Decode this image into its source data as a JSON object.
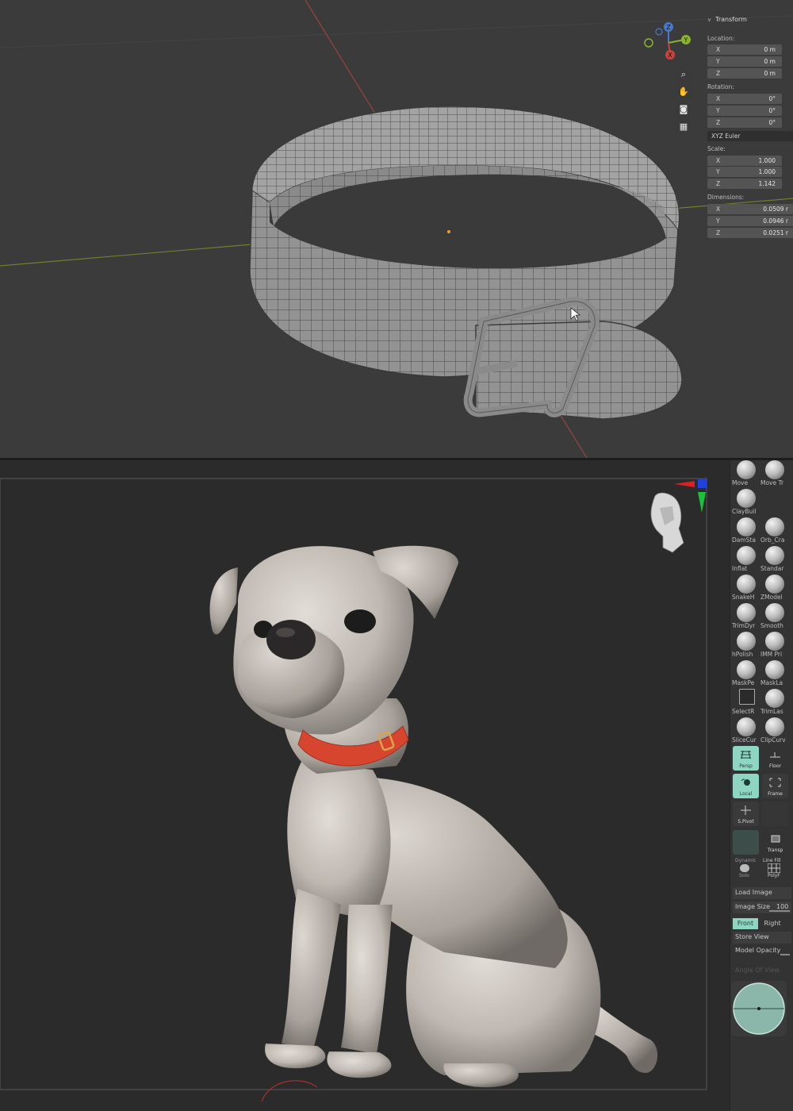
{
  "blender": {
    "panel": {
      "title": "Transform",
      "location": {
        "label": "Location:",
        "rows": [
          {
            "axis": "X",
            "value": "0 m"
          },
          {
            "axis": "Y",
            "value": "0 m"
          },
          {
            "axis": "Z",
            "value": "0 m"
          }
        ]
      },
      "rotation": {
        "label": "Rotation:",
        "rows": [
          {
            "axis": "X",
            "value": "0°"
          },
          {
            "axis": "Y",
            "value": "0°"
          },
          {
            "axis": "Z",
            "value": "0°"
          }
        ],
        "mode": "XYZ Euler"
      },
      "scale": {
        "label": "Scale:",
        "rows": [
          {
            "axis": "X",
            "value": "1.000"
          },
          {
            "axis": "Y",
            "value": "1.000"
          },
          {
            "axis": "Z",
            "value": "1.142"
          }
        ]
      },
      "dimensions": {
        "label": "Dimensions:",
        "rows": [
          {
            "axis": "X",
            "value": "0.0509 r"
          },
          {
            "axis": "Y",
            "value": "0.0946 r"
          },
          {
            "axis": "Z",
            "value": "0.0251 r"
          }
        ]
      }
    },
    "gizmo": {
      "axes": {
        "x": "X",
        "y": "Y",
        "z": "Z"
      },
      "tools": [
        "zoom-icon",
        "pan-hand-icon",
        "camera-icon",
        "grid-icon"
      ]
    },
    "colors": {
      "viewport_bg": "#3a3a3a",
      "mesh": "#8f8f8f",
      "wire": "#3f3f3f",
      "x_axis": "#c0504d",
      "y_axis": "#7a9a3a",
      "z_axis": "#4a78c8"
    }
  },
  "zbrush": {
    "brushes": [
      {
        "left": "Move",
        "right": "Move Tr"
      },
      {
        "left": "ClayBuil",
        "right": ""
      },
      {
        "left": "DamSta",
        "right": "Orb_Cra"
      },
      {
        "left": "Inflat",
        "right": "Standar"
      },
      {
        "left": "SnakeH",
        "right": "ZModel"
      },
      {
        "left": "TrimDyr",
        "right": "Smooth"
      },
      {
        "left": "hPolish",
        "right": "IMM Pri"
      },
      {
        "left": "MaskPe",
        "right": "MaskLa"
      },
      {
        "left": "SelectR",
        "right": "TrimLas"
      },
      {
        "left": "SliceCur",
        "right": "ClipCurv"
      }
    ],
    "view_buttons": [
      {
        "left": "Persp",
        "right": "Floor"
      },
      {
        "left": "Local",
        "right": "Frame"
      },
      {
        "left": "S.Pivot",
        "right": ""
      },
      {
        "left": "",
        "right": "Transp"
      }
    ],
    "extra_labels": {
      "dynamic": "Dynamic",
      "line_fill": "Line Fill",
      "solo": "Solo",
      "polyf": "PolyF"
    },
    "load_image": "Load Image",
    "image_size": {
      "label": "Image Size",
      "value": "100"
    },
    "view_tabs": {
      "front": "Front",
      "right": "Right"
    },
    "store_view": "Store View",
    "model_opacity": "Model Opacity",
    "angle_of_view": "Angle Of View",
    "colors": {
      "accent": "#8fd6c2",
      "clay": "#c9c3bd",
      "collar": "#d7452e",
      "bg": "#2b2b2b"
    }
  }
}
